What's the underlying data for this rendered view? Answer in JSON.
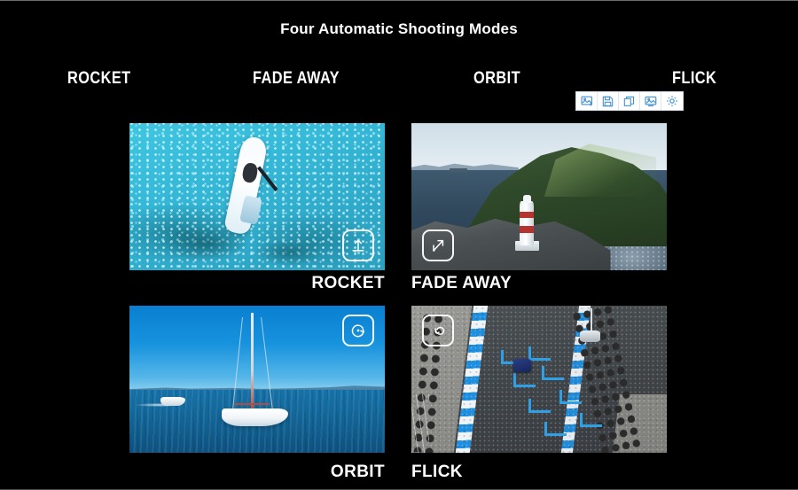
{
  "page": {
    "title": "Four Automatic Shooting Modes",
    "background_color": "#000000",
    "text_color": "#ffffff"
  },
  "top_labels": [
    {
      "label": "ROCKET"
    },
    {
      "label": "FADE AWAY"
    },
    {
      "label": "ORBIT"
    },
    {
      "label": "FLICK"
    }
  ],
  "toolbar": {
    "accent_color": "#3d8fd6",
    "background_color": "#ffffff",
    "buttons": [
      {
        "icon": "add-image-icon"
      },
      {
        "icon": "save-icon"
      },
      {
        "icon": "copy-icon"
      },
      {
        "icon": "image-icon"
      },
      {
        "icon": "gear-icon"
      }
    ]
  },
  "tiles": [
    {
      "mode": "ROCKET",
      "caption": "ROCKET",
      "icon": "rocket-launch-icon",
      "scene": "Aerial view of a paddleboarder on turquoise water"
    },
    {
      "mode": "FADE AWAY",
      "caption": "FADE AWAY",
      "icon": "fade-away-arrow-icon",
      "scene": "Coastal headland with red and white lighthouse"
    },
    {
      "mode": "ORBIT",
      "caption": "ORBIT",
      "icon": "orbit-icon",
      "scene": "White sailboat on blue sea"
    },
    {
      "mode": "FLICK",
      "caption": "FLICK",
      "icon": "flick-spiral-icon",
      "scene": "Go-kart on a racetrack with blue kerbs"
    }
  ]
}
